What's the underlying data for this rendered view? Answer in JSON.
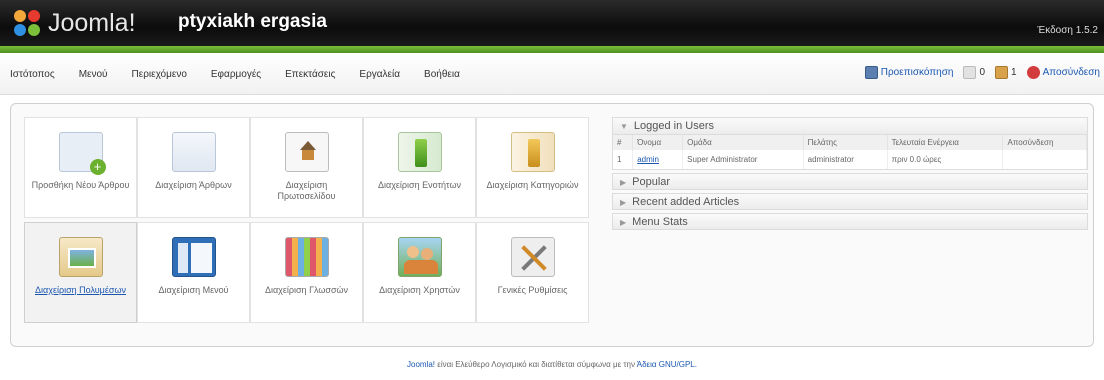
{
  "header": {
    "logo_text": "Joomla!",
    "site_name": "ptyxiakh ergasia",
    "version": "Έκδοση 1.5.2"
  },
  "menu": [
    "Ιστότοπος",
    "Μενού",
    "Περιεχόμενο",
    "Εφαρμογές",
    "Επεκτάσεις",
    "Εργαλεία",
    "Βοήθεια"
  ],
  "status": {
    "preview": "Προεπισκόπηση",
    "messages": "0",
    "users_online": "1",
    "logout": "Αποσύνδεση"
  },
  "tiles": [
    {
      "label": "Προσθήκη Νέου Άρθρου",
      "icon": "add-article-icon"
    },
    {
      "label": "Διαχείριση Άρθρων",
      "icon": "article-manager-icon"
    },
    {
      "label": "Διαχείριση Πρωτοσελίδου",
      "icon": "frontpage-manager-icon"
    },
    {
      "label": "Διαχείριση Ενοτήτων",
      "icon": "section-manager-icon"
    },
    {
      "label": "Διαχείριση Κατηγοριών",
      "icon": "category-manager-icon"
    },
    {
      "label": "Διαχείριση Πολυμέσων",
      "icon": "media-manager-icon"
    },
    {
      "label": "Διαχείριση Μενού",
      "icon": "menu-manager-icon"
    },
    {
      "label": "Διαχείριση Γλωσσών",
      "icon": "language-manager-icon"
    },
    {
      "label": "Διαχείριση Χρηστών",
      "icon": "user-manager-icon"
    },
    {
      "label": "Γενικές Ρυθμίσεις",
      "icon": "global-config-icon"
    }
  ],
  "logged_users": {
    "title": "Logged in Users",
    "columns": [
      "#",
      "Όνομα",
      "Ομάδα",
      "Πελάτης",
      "Τελευταία Ενέργεια",
      "Αποσύνδεση"
    ],
    "rows": [
      {
        "num": "1",
        "name": "admin",
        "group": "Super Administrator",
        "client": "administrator",
        "last": "πριν 0.0 ώρες",
        "logout": ""
      }
    ]
  },
  "panels": [
    "Popular",
    "Recent added Articles",
    "Menu Stats"
  ],
  "footer": {
    "brand": "Joomla!",
    "text": " είναι Ελεύθερο Λογισμικό και διατίθεται σύμφωνα με την ",
    "license": "Άδεια GNU/GPL."
  },
  "colors": {
    "accent": "#1b57b1",
    "header_green": "#6bb02f"
  }
}
